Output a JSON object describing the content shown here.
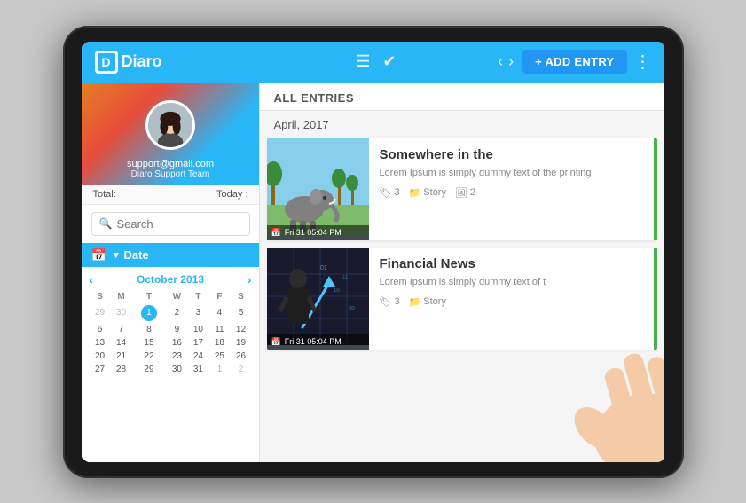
{
  "app": {
    "name": "Diaro",
    "logo_letter": "D"
  },
  "topbar": {
    "add_entry_label": "+ ADD ENTRY",
    "nav_prev": "‹",
    "nav_next": "›"
  },
  "sidebar": {
    "profile_email": "support@gmail.com",
    "profile_team": "Diaro Support Team",
    "total_label": "Total:",
    "today_label": "Today :",
    "search_placeholder": "Search",
    "date_section_label": "Date",
    "calendar": {
      "month": "October 2013",
      "days_header": [
        "S",
        "M",
        "T",
        "W",
        "T",
        "F",
        "S"
      ],
      "weeks": [
        [
          "29",
          "30",
          "1",
          "2",
          "3",
          "4",
          "5"
        ],
        [
          "6",
          "7",
          "8",
          "9",
          "10",
          "11",
          "12"
        ],
        [
          "13",
          "14",
          "15",
          "16",
          "17",
          "18",
          "19"
        ],
        [
          "20",
          "21",
          "22",
          "23",
          "24",
          "25",
          "26"
        ],
        [
          "27",
          "28",
          "29",
          "30",
          "31",
          "1",
          "2"
        ]
      ],
      "today_day": "1",
      "today_week": 0,
      "today_col": 2
    }
  },
  "content": {
    "header": "ALL ENTRIES",
    "section_date": "April, 2017",
    "entries": [
      {
        "title": "Somewhere in the",
        "excerpt": "Lorem Ipsum is simply dummy text of the printing",
        "date_label": "Fri 31  05:04 PM",
        "tag_count": "3",
        "category": "Story",
        "image_count": "2",
        "type": "elephant"
      },
      {
        "title": "Financial News",
        "excerpt": "Lorem Ipsum is simply dummy text of t",
        "date_label": "Fri 31  05:04 PM",
        "tag_count": "3",
        "category": "Story",
        "image_count": "",
        "type": "business"
      }
    ]
  }
}
